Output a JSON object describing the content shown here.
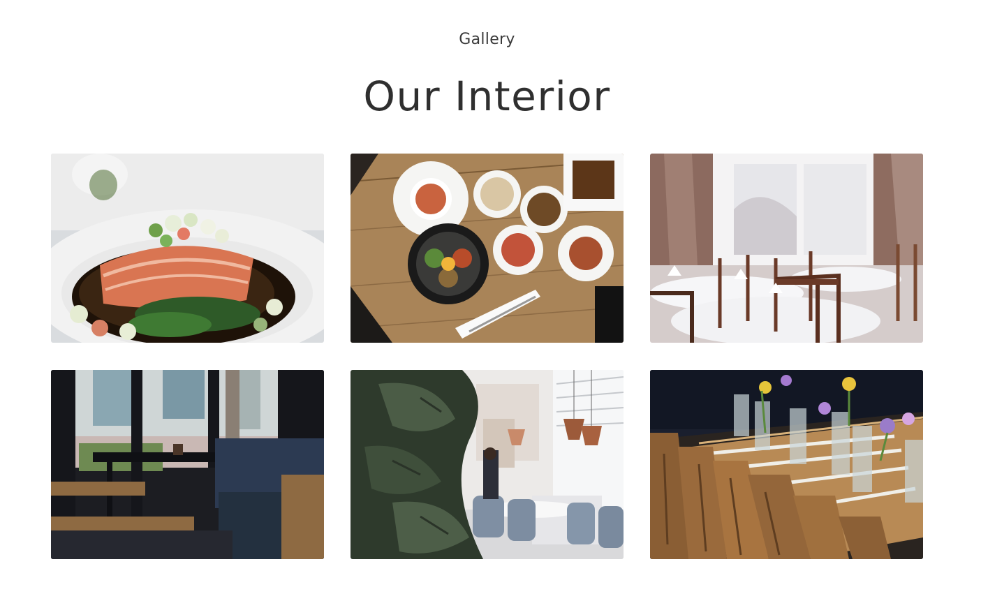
{
  "section": {
    "subtitle": "Gallery",
    "title": "Our Interior"
  },
  "gallery": {
    "images": [
      {
        "subject": "salmon-dish-photo"
      },
      {
        "subject": "korean-table-spread-photo"
      },
      {
        "subject": "dining-room-window-photo"
      },
      {
        "subject": "cafe-window-seating-photo"
      },
      {
        "subject": "bright-restaurant-plant-photo"
      },
      {
        "subject": "long-wooden-table-flowers-photo"
      }
    ]
  },
  "colors": {
    "text": "#333333",
    "background": "#ffffff"
  }
}
